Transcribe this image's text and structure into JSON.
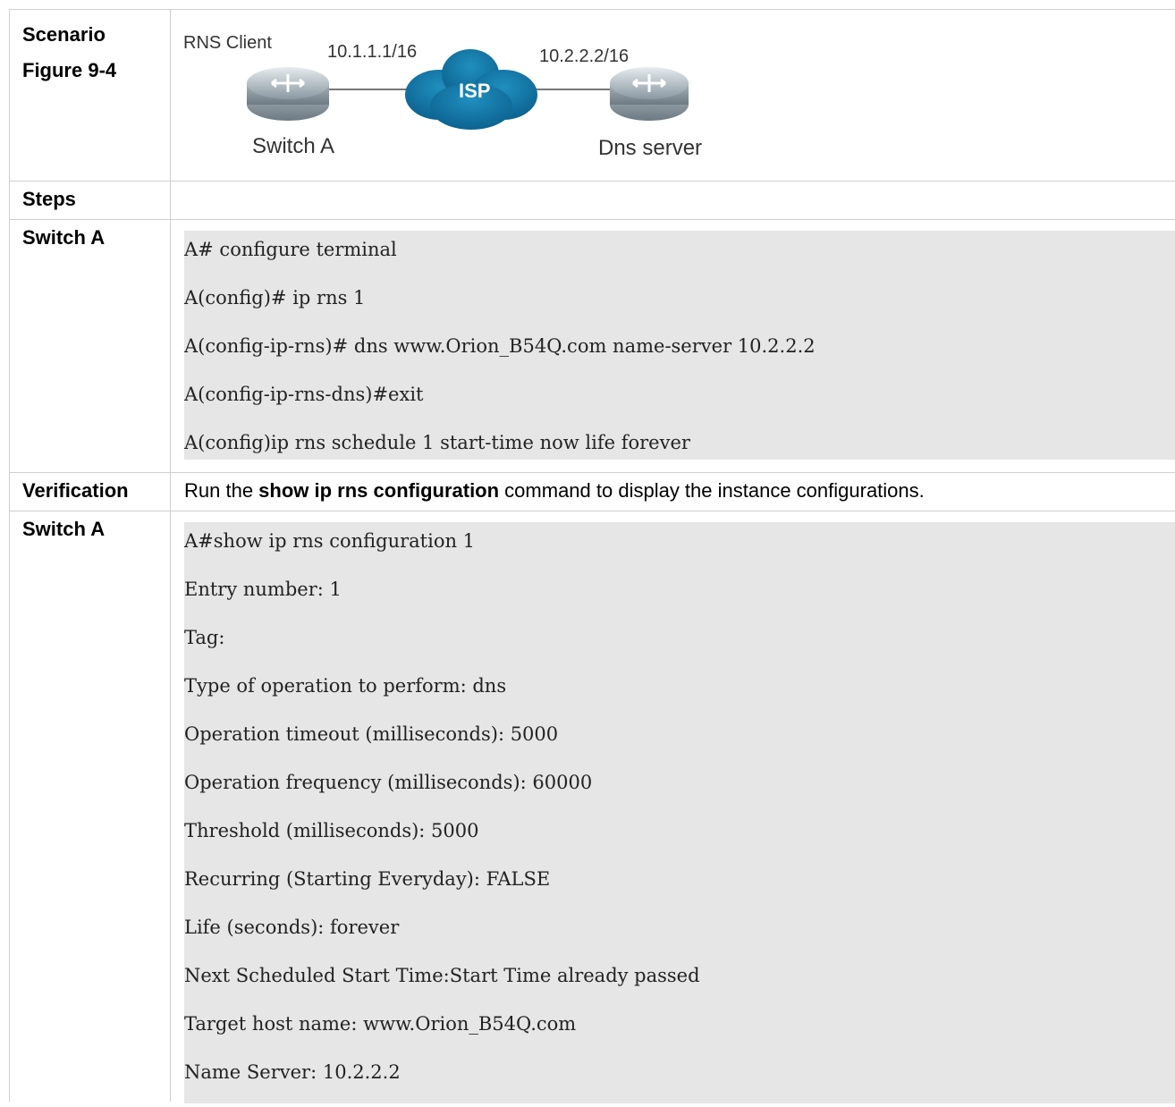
{
  "rows": {
    "scenario": {
      "label_line1": "Scenario",
      "label_line2": "Figure 9-4",
      "diagram": {
        "rns_client": "RNS Client",
        "left_ip": "10.1.1.1/16",
        "right_ip": "10.2.2.2/16",
        "cloud_label": "ISP",
        "left_device": "Switch A",
        "right_device": "Dns server"
      }
    },
    "steps": {
      "label": "Steps"
    },
    "config": {
      "label": "Switch A",
      "lines": [
        "A# configure terminal",
        "A(config)# ip rns 1",
        "A(config-ip-rns)# dns www.Orion_B54Q.com name-server 10.2.2.2",
        "A(config-ip-rns-dns)#exit",
        "A(config)ip rns schedule 1 start-time now life forever"
      ]
    },
    "verification": {
      "label": "Verification",
      "text_before": "Run the ",
      "command": "show ip rns configuration",
      "text_after": " command to display the instance configurations."
    },
    "output": {
      "label": "Switch A",
      "lines": [
        "A#show ip rns configuration 1",
        "Entry number: 1",
        "Tag:",
        "Type of operation to perform: dns",
        "Operation timeout (milliseconds): 5000",
        "Operation frequency (milliseconds): 60000",
        "Threshold (milliseconds): 5000",
        "Recurring (Starting Everyday): FALSE",
        "Life (seconds): forever",
        "Next Scheduled Start Time:Start Time already passed",
        "Target host name: www.Orion_B54Q.com",
        "Name Server: 10.2.2.2"
      ]
    }
  }
}
